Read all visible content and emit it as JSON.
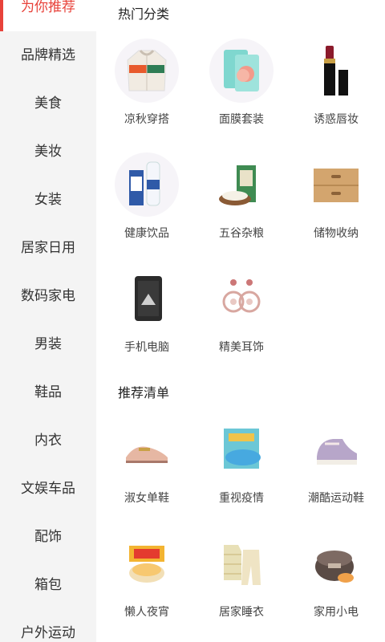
{
  "sidebar": {
    "items": [
      {
        "label": "为你推荐",
        "active": true
      },
      {
        "label": "品牌精选"
      },
      {
        "label": "美食"
      },
      {
        "label": "美妆"
      },
      {
        "label": "女装"
      },
      {
        "label": "居家日用"
      },
      {
        "label": "数码家电"
      },
      {
        "label": "男装"
      },
      {
        "label": "鞋品"
      },
      {
        "label": "内衣"
      },
      {
        "label": "文娱车品"
      },
      {
        "label": "配饰"
      },
      {
        "label": "箱包"
      },
      {
        "label": "户外运动"
      }
    ]
  },
  "sections": {
    "hot": {
      "title": "热门分类",
      "items": [
        {
          "label": "凉秋穿搭",
          "icon": "jacket-icon"
        },
        {
          "label": "面膜套装",
          "icon": "face-mask-box-icon"
        },
        {
          "label": "诱惑唇妆",
          "icon": "lipstick-icon"
        },
        {
          "label": "健康饮品",
          "icon": "milk-bottle-icon"
        },
        {
          "label": "五谷杂粮",
          "icon": "rice-bag-icon"
        },
        {
          "label": "储物收纳",
          "icon": "drawer-box-icon"
        },
        {
          "label": "手机电脑",
          "icon": "phone-icon"
        },
        {
          "label": "精美耳饰",
          "icon": "earrings-icon"
        }
      ]
    },
    "recommend": {
      "title": "推荐清单",
      "items": [
        {
          "label": "淑女单鞋",
          "icon": "loafer-shoe-icon"
        },
        {
          "label": "重视疫情",
          "icon": "medical-mask-icon"
        },
        {
          "label": "潮酷运动鞋",
          "icon": "sneaker-icon"
        },
        {
          "label": "懒人夜宵",
          "icon": "instant-noodle-icon"
        },
        {
          "label": "居家睡衣",
          "icon": "pajamas-icon"
        },
        {
          "label": "家用小电",
          "icon": "rice-cooker-icon"
        }
      ]
    }
  },
  "colors": {
    "accent": "#e8423a",
    "sidebar_bg": "#f4f4f4"
  }
}
